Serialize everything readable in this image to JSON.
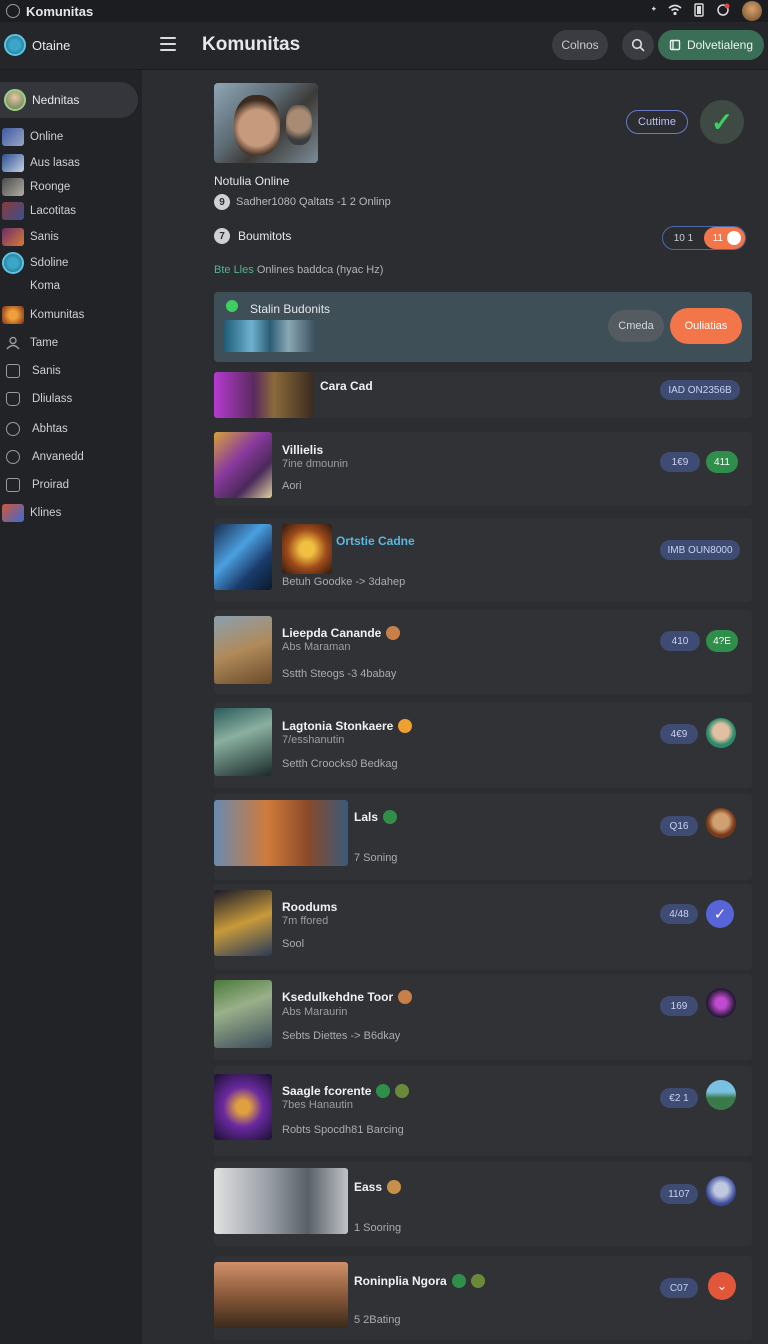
{
  "statusbar": {
    "app_title": "Komunitas"
  },
  "topbar": {
    "user_label": "Otaine",
    "title": "Komunitas",
    "btn_colnos": "Colnos",
    "btn_primary": "Dolvetialeng"
  },
  "sidebar": {
    "active_label": "Nednitas",
    "items": [
      {
        "label": "Online",
        "color": "#3d5a9e"
      },
      {
        "label": "Aus lasas",
        "color": "#2b4f8f"
      },
      {
        "label": "Roonge",
        "color": "#6b6a68"
      },
      {
        "label": "Lacotitas",
        "color": "#8a3a3a"
      },
      {
        "label": "Sanis",
        "color": "#6a2e6a"
      },
      {
        "label": "Sdoline",
        "color": "#2f8fb3"
      },
      {
        "label": "Koma",
        "color": "#2b2d31"
      },
      {
        "label": "Komunitas",
        "color": "#c2551f"
      },
      {
        "label": "Tame",
        "icon": "user-icon"
      },
      {
        "label": "Sanis",
        "icon": "doc-icon"
      },
      {
        "label": "Dliulass",
        "icon": "folder-icon"
      },
      {
        "label": "Abhtas",
        "icon": "settings-icon"
      },
      {
        "label": "Anvanedd",
        "icon": "gear-icon"
      },
      {
        "label": "Proirad",
        "icon": "box-icon"
      },
      {
        "label": "Klines",
        "color": "#d2563a"
      }
    ]
  },
  "profile": {
    "title": "Notulia Online",
    "sub_num": "9",
    "sub_text": "Sadher1080 Qaltats  -1 2 Onlinp",
    "btn_outline": "Cuttime"
  },
  "bounties": {
    "num": "7",
    "label": "Boumitots",
    "toggle_left": "10 1",
    "toggle_right": "11"
  },
  "hint": {
    "accent": "Bte Lles",
    "text": "Onlines baddca (hyac Hz)"
  },
  "highlight": {
    "title": "Stalin Budonits",
    "btn_gray": "Cmeda",
    "btn_orange": "Ouliatias"
  },
  "rows": [
    {
      "title": "Cara Cad",
      "sub": "",
      "line": "",
      "badge": "IAD ON2356B"
    },
    {
      "title": "Villielis",
      "sub": "7ine dmounin",
      "line": "Aori",
      "badge": "1€9",
      "status": "411"
    },
    {
      "title": "Ortstie Cadne",
      "sub": "",
      "line": "Betuh Goodke -> 3dahep",
      "badge": "IMB OUN8000"
    },
    {
      "title": "Lieepda Canande",
      "sub": "Abs Maraman",
      "line": "Sstth Steogs -3 4babay",
      "badge": "410",
      "status": "4?E"
    },
    {
      "title": "Lagtonia Stonkaere",
      "sub": "7/esshanutin",
      "line": "Setth Croocks0 Bedkag",
      "badge": "4€9"
    },
    {
      "title": "Lals",
      "sub": "",
      "line": "7 Soning",
      "badge": "Q16"
    },
    {
      "title": "Roodums",
      "sub": "7m ffored",
      "line": "Sool",
      "badge": "4/48"
    },
    {
      "title": "Ksedulkehdne Toor",
      "sub": "Abs Maraurin",
      "line": "Sebts Diettes -> B6dkay",
      "badge": "169"
    },
    {
      "title": "Saagle fcorente",
      "sub": "7bes Hanautin",
      "line": "Robts Spocdh81 Barcing",
      "badge": "€2 1"
    },
    {
      "title": "Eass",
      "sub": "",
      "line": "1 Sooring",
      "badge": "1107"
    },
    {
      "title": "Roninplia Ngora",
      "sub": "",
      "line": "5 2Bating",
      "badge": "C07"
    }
  ],
  "colors": {
    "accent_orange": "#f2764a",
    "accent_green": "#3ecf62",
    "primary_green": "#3b6e56",
    "badge_blue": "#3e4c74"
  }
}
